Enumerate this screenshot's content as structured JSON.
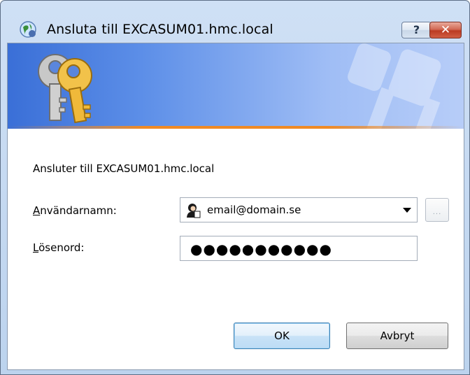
{
  "window": {
    "title": "Ansluta till EXCASUM01.hmc.local",
    "help_label": "?",
    "close_label": "✕"
  },
  "dialog": {
    "connecting_text": "Ansluter till EXCASUM01.hmc.local",
    "username_label_accel": "A",
    "username_label_rest": "nvändarnamn:",
    "username_value": "email@domain.se",
    "browse_label": "...",
    "password_label_accel": "L",
    "password_label_rest": "ösenord:",
    "password_masked": "●●●●●●●●●●●"
  },
  "buttons": {
    "ok_label": "OK",
    "cancel_label": "Avbryt"
  },
  "colors": {
    "banner_accent": "#f08a24",
    "banner_blue": "#3a6fd7"
  }
}
